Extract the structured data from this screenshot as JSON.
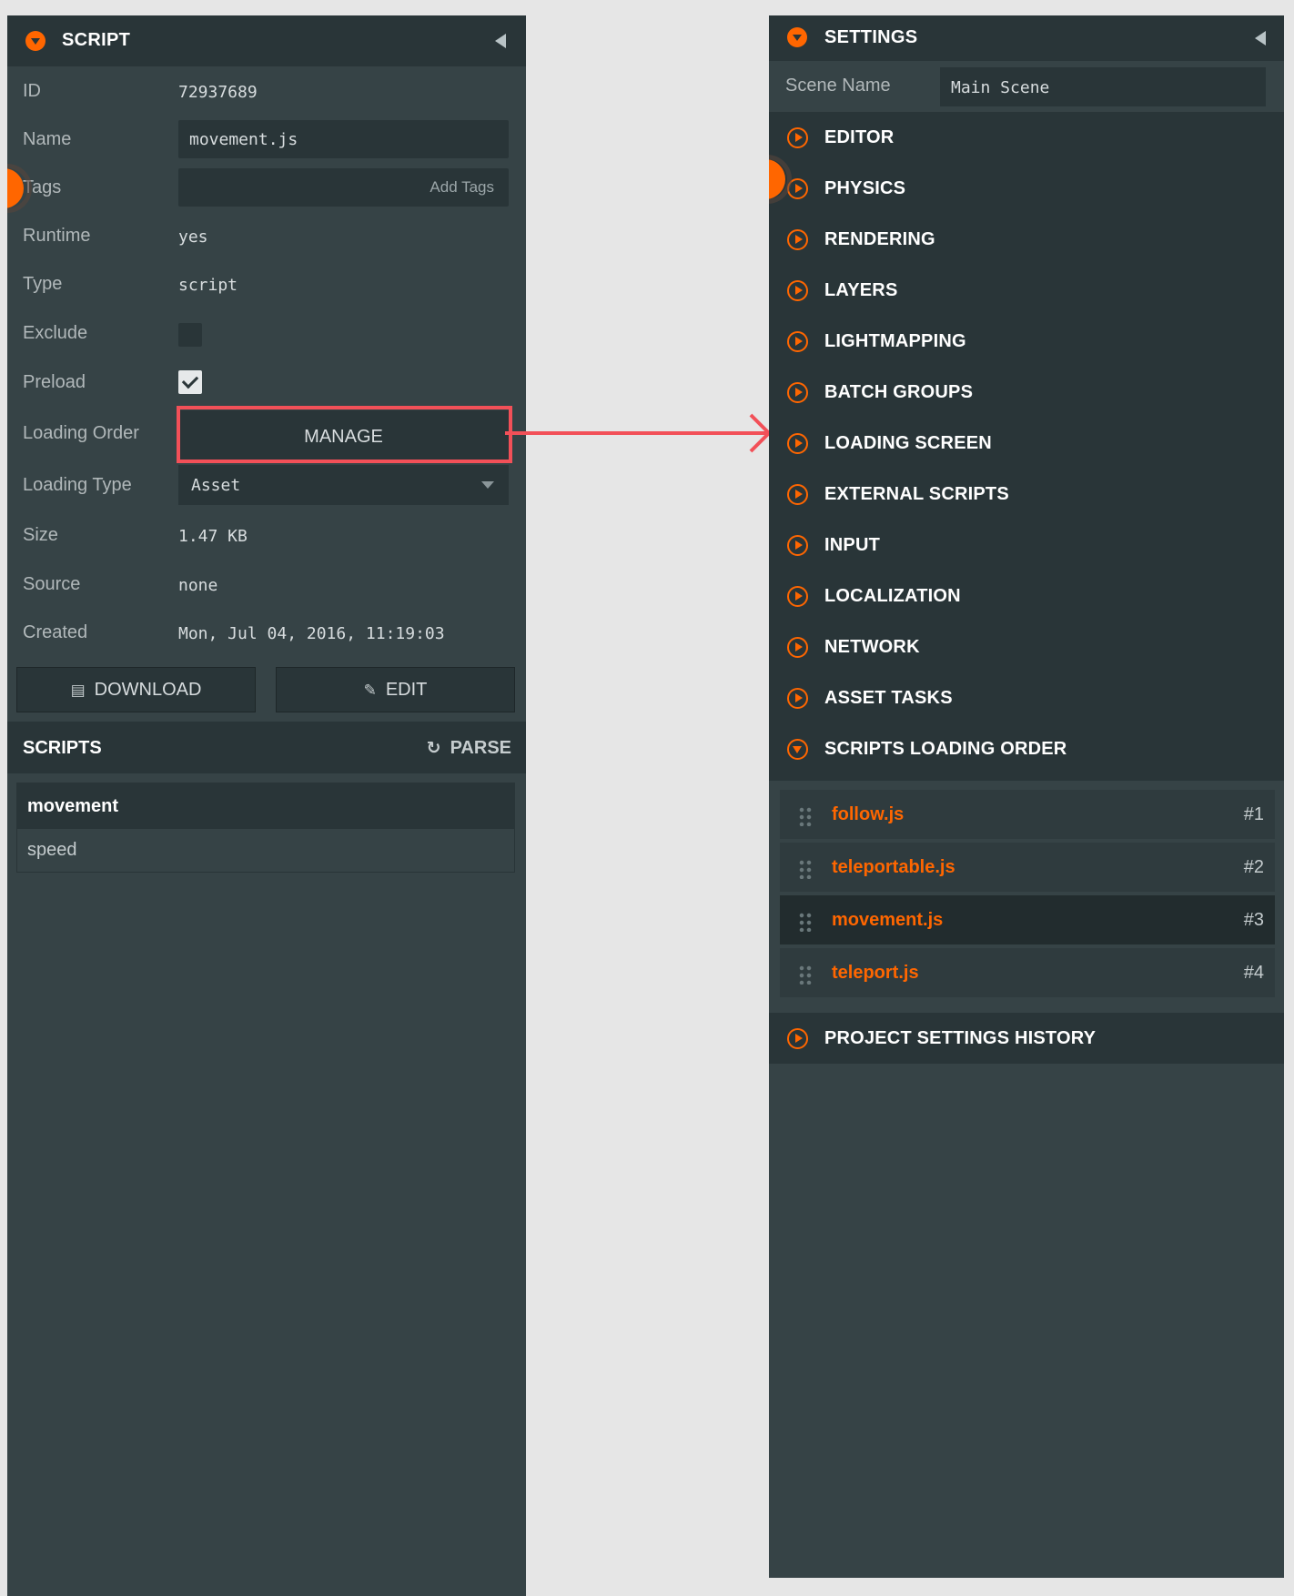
{
  "script_panel": {
    "title": "SCRIPT",
    "fields": {
      "id": {
        "label": "ID",
        "value": "72937689"
      },
      "name": {
        "label": "Name",
        "value": "movement.js"
      },
      "tags": {
        "label": "Tags",
        "placeholder": "Add Tags"
      },
      "runtime": {
        "label": "Runtime",
        "value": "yes"
      },
      "type": {
        "label": "Type",
        "value": "script"
      },
      "exclude": {
        "label": "Exclude",
        "checked": false
      },
      "preload": {
        "label": "Preload",
        "checked": true
      },
      "loading_order": {
        "label": "Loading Order",
        "button": "MANAGE"
      },
      "loading_type": {
        "label": "Loading Type",
        "value": "Asset"
      },
      "size": {
        "label": "Size",
        "value": "1.47 KB"
      },
      "source": {
        "label": "Source",
        "value": "none"
      },
      "created": {
        "label": "Created",
        "value": "Mon, Jul 04, 2016, 11:19:03"
      }
    },
    "buttons": {
      "download": "DOWNLOAD",
      "edit": "EDIT"
    },
    "scripts_section": {
      "title": "SCRIPTS",
      "parse": "PARSE",
      "script_name": "movement",
      "attribute": "speed"
    }
  },
  "settings_panel": {
    "title": "SETTINGS",
    "scene_name": {
      "label": "Scene Name",
      "value": "Main Scene"
    },
    "items": [
      {
        "label": "EDITOR"
      },
      {
        "label": "PHYSICS"
      },
      {
        "label": "RENDERING"
      },
      {
        "label": "LAYERS"
      },
      {
        "label": "LIGHTMAPPING"
      },
      {
        "label": "BATCH GROUPS"
      },
      {
        "label": "LOADING SCREEN"
      },
      {
        "label": "EXTERNAL SCRIPTS"
      },
      {
        "label": "INPUT"
      },
      {
        "label": "LOCALIZATION"
      },
      {
        "label": "NETWORK"
      },
      {
        "label": "ASSET TASKS"
      },
      {
        "label": "SCRIPTS LOADING ORDER",
        "expanded": true
      }
    ],
    "loading_order": [
      {
        "name": "follow.js",
        "index": "#1"
      },
      {
        "name": "teleportable.js",
        "index": "#2"
      },
      {
        "name": "movement.js",
        "index": "#3",
        "selected": true
      },
      {
        "name": "teleport.js",
        "index": "#4"
      }
    ],
    "history": "PROJECT SETTINGS HISTORY"
  },
  "colors": {
    "accent": "#ff6600",
    "highlight": "#f25058",
    "panel": "#364346",
    "panel_dark": "#293538"
  },
  "icons": [
    "collapse-arrow-icon",
    "chevron-down-icon",
    "play-circle-icon",
    "floppy-icon",
    "edit-icon",
    "refresh-icon",
    "drag-grip-icon"
  ]
}
